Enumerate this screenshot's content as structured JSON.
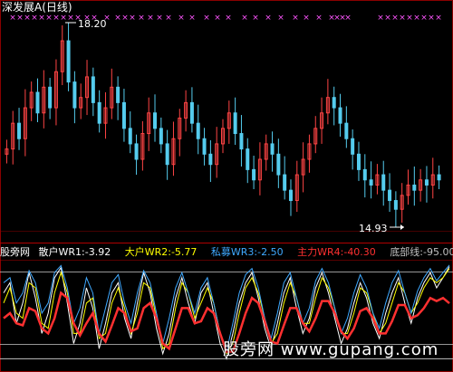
{
  "title": "深发展A(日线)",
  "price_labels": {
    "high": "18.20",
    "low": "14.93",
    "max": "",
    "mid": ""
  },
  "indicator": {
    "name": "股旁网",
    "wr1": {
      "label": "散户WR1:",
      "value": "-3.92",
      "color": "#ffffff"
    },
    "wr2": {
      "label": "大户WR2:",
      "value": "-5.77",
      "color": "#ffff00"
    },
    "wr3": {
      "label": "私募WR3:",
      "value": "-2.50",
      "color": "#3fa9ff"
    },
    "wr4": {
      "label": "主力WR4:",
      "value": "-40.30",
      "color": "#ff3030"
    },
    "base": {
      "label": "底部线:",
      "value": "-95.00",
      "color": "#c0c0c0"
    }
  },
  "watermark": "股旁网 www.gupang.com",
  "colors": {
    "up": "#ff4444",
    "down": "#55ccee",
    "marker": "#ff55ff",
    "bg": "#000000"
  },
  "chart_data": {
    "type": "line",
    "candles_close": [
      16.1,
      16.6,
      16.3,
      16.9,
      17.2,
      16.8,
      17.3,
      16.9,
      17.6,
      18.2,
      17.4,
      16.9,
      17.1,
      17.5,
      17.0,
      16.6,
      16.9,
      17.3,
      17.0,
      16.5,
      16.2,
      15.9,
      16.4,
      16.8,
      16.5,
      16.2,
      15.8,
      16.3,
      16.7,
      17.0,
      16.6,
      16.3,
      16.0,
      15.8,
      16.2,
      16.5,
      16.8,
      16.4,
      16.1,
      15.7,
      15.5,
      15.9,
      16.2,
      16.0,
      15.6,
      15.3,
      15.1,
      15.6,
      15.9,
      16.2,
      16.5,
      16.8,
      17.1,
      16.9,
      16.6,
      16.3,
      16.0,
      15.7,
      15.5,
      15.4,
      15.6,
      15.3,
      15.1,
      14.93,
      15.2,
      15.4,
      15.3,
      15.5,
      15.4,
      15.6,
      15.5
    ],
    "ylim": [
      14.6,
      18.5
    ],
    "series": [
      {
        "name": "散户WR1",
        "values": [
          -30,
          -20,
          -60,
          -40,
          -10,
          -35,
          -70,
          -50,
          -15,
          -5,
          -40,
          -80,
          -60,
          -25,
          -45,
          -85,
          -60,
          -30,
          -20,
          -55,
          -75,
          -40,
          -10,
          -30,
          -65,
          -90,
          -70,
          -35,
          -15,
          -40,
          -60,
          -30,
          -20,
          -50,
          -80,
          -95,
          -70,
          -40,
          -20,
          -10,
          -35,
          -65,
          -85,
          -60,
          -30,
          -15,
          -45,
          -70,
          -55,
          -25,
          -10,
          -30,
          -55,
          -80,
          -65,
          -40,
          -20,
          -35,
          -60,
          -75,
          -50,
          -30,
          -15,
          -40,
          -60,
          -35,
          -20,
          -10,
          -25,
          -15,
          -4
        ]
      },
      {
        "name": "大户WR2",
        "values": [
          -40,
          -25,
          -50,
          -55,
          -20,
          -25,
          -60,
          -65,
          -30,
          -10,
          -30,
          -70,
          -70,
          -40,
          -35,
          -75,
          -70,
          -40,
          -25,
          -45,
          -70,
          -50,
          -20,
          -25,
          -55,
          -85,
          -80,
          -45,
          -20,
          -30,
          -55,
          -40,
          -25,
          -40,
          -70,
          -90,
          -80,
          -50,
          -25,
          -15,
          -30,
          -55,
          -80,
          -70,
          -40,
          -20,
          -35,
          -60,
          -60,
          -35,
          -15,
          -25,
          -45,
          -70,
          -70,
          -50,
          -25,
          -30,
          -50,
          -70,
          -60,
          -40,
          -20,
          -30,
          -50,
          -40,
          -25,
          -15,
          -20,
          -15,
          -6
        ]
      },
      {
        "name": "私募WR3",
        "values": [
          -20,
          -15,
          -40,
          -30,
          -8,
          -20,
          -50,
          -40,
          -10,
          -3,
          -25,
          -60,
          -45,
          -15,
          -30,
          -70,
          -45,
          -20,
          -12,
          -40,
          -60,
          -30,
          -8,
          -20,
          -50,
          -80,
          -55,
          -25,
          -10,
          -30,
          -50,
          -25,
          -15,
          -40,
          -70,
          -88,
          -60,
          -30,
          -12,
          -6,
          -25,
          -55,
          -75,
          -50,
          -20,
          -10,
          -35,
          -60,
          -45,
          -18,
          -6,
          -20,
          -45,
          -70,
          -55,
          -30,
          -12,
          -25,
          -50,
          -65,
          -40,
          -20,
          -8,
          -30,
          -50,
          -28,
          -15,
          -6,
          -18,
          -10,
          -2.5
        ]
      },
      {
        "name": "主力WR4",
        "values": [
          -55,
          -50,
          -60,
          -62,
          -45,
          -48,
          -65,
          -70,
          -55,
          -30,
          -35,
          -60,
          -72,
          -60,
          -50,
          -70,
          -78,
          -62,
          -45,
          -50,
          -68,
          -65,
          -45,
          -40,
          -55,
          -80,
          -85,
          -65,
          -45,
          -45,
          -60,
          -58,
          -45,
          -50,
          -70,
          -88,
          -88,
          -70,
          -50,
          -35,
          -40,
          -58,
          -78,
          -80,
          -62,
          -45,
          -45,
          -60,
          -68,
          -55,
          -38,
          -38,
          -50,
          -68,
          -75,
          -65,
          -48,
          -45,
          -55,
          -70,
          -70,
          -58,
          -42,
          -42,
          -55,
          -52,
          -45,
          -35,
          -38,
          -35,
          -40.3
        ]
      },
      {
        "name": "底部线",
        "values": [
          -95
        ]
      }
    ]
  }
}
